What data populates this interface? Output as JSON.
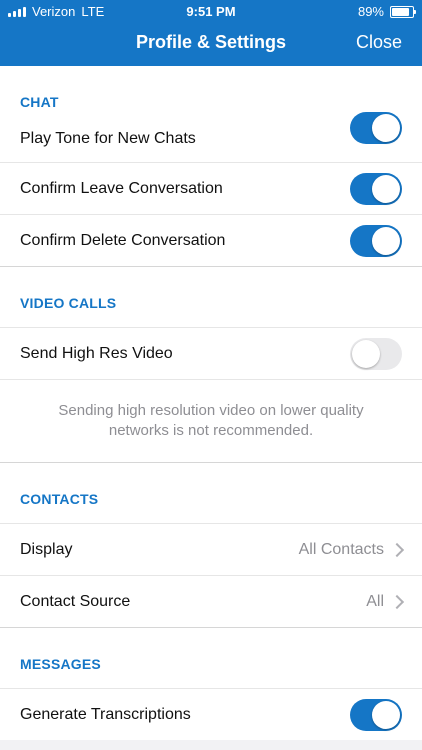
{
  "status": {
    "carrier": "Verizon",
    "network": "LTE",
    "time": "9:51 PM",
    "battery": "89%"
  },
  "nav": {
    "title": "Profile & Settings",
    "close": "Close"
  },
  "sections": {
    "chat": {
      "header": "CHAT",
      "rows": [
        {
          "label": "Play Tone for New Chats",
          "toggle": true
        },
        {
          "label": "Confirm Leave Conversation",
          "toggle": true
        },
        {
          "label": "Confirm Delete Conversation",
          "toggle": true
        }
      ]
    },
    "video": {
      "header": "VIDEO CALLS",
      "rows": [
        {
          "label": "Send High Res Video",
          "toggle": false
        }
      ],
      "note": "Sending high resolution video on lower quality networks is not recommended."
    },
    "contacts": {
      "header": "CONTACTS",
      "rows": [
        {
          "label": "Display",
          "value": "All Contacts"
        },
        {
          "label": "Contact Source",
          "value": "All"
        }
      ]
    },
    "messages": {
      "header": "MESSAGES",
      "rows": [
        {
          "label": "Generate Transcriptions",
          "toggle": true
        }
      ]
    }
  },
  "colors": {
    "accent": "#1576c6",
    "toggle_off": "#e9e9eb",
    "secondary_text": "#8e8e93"
  }
}
